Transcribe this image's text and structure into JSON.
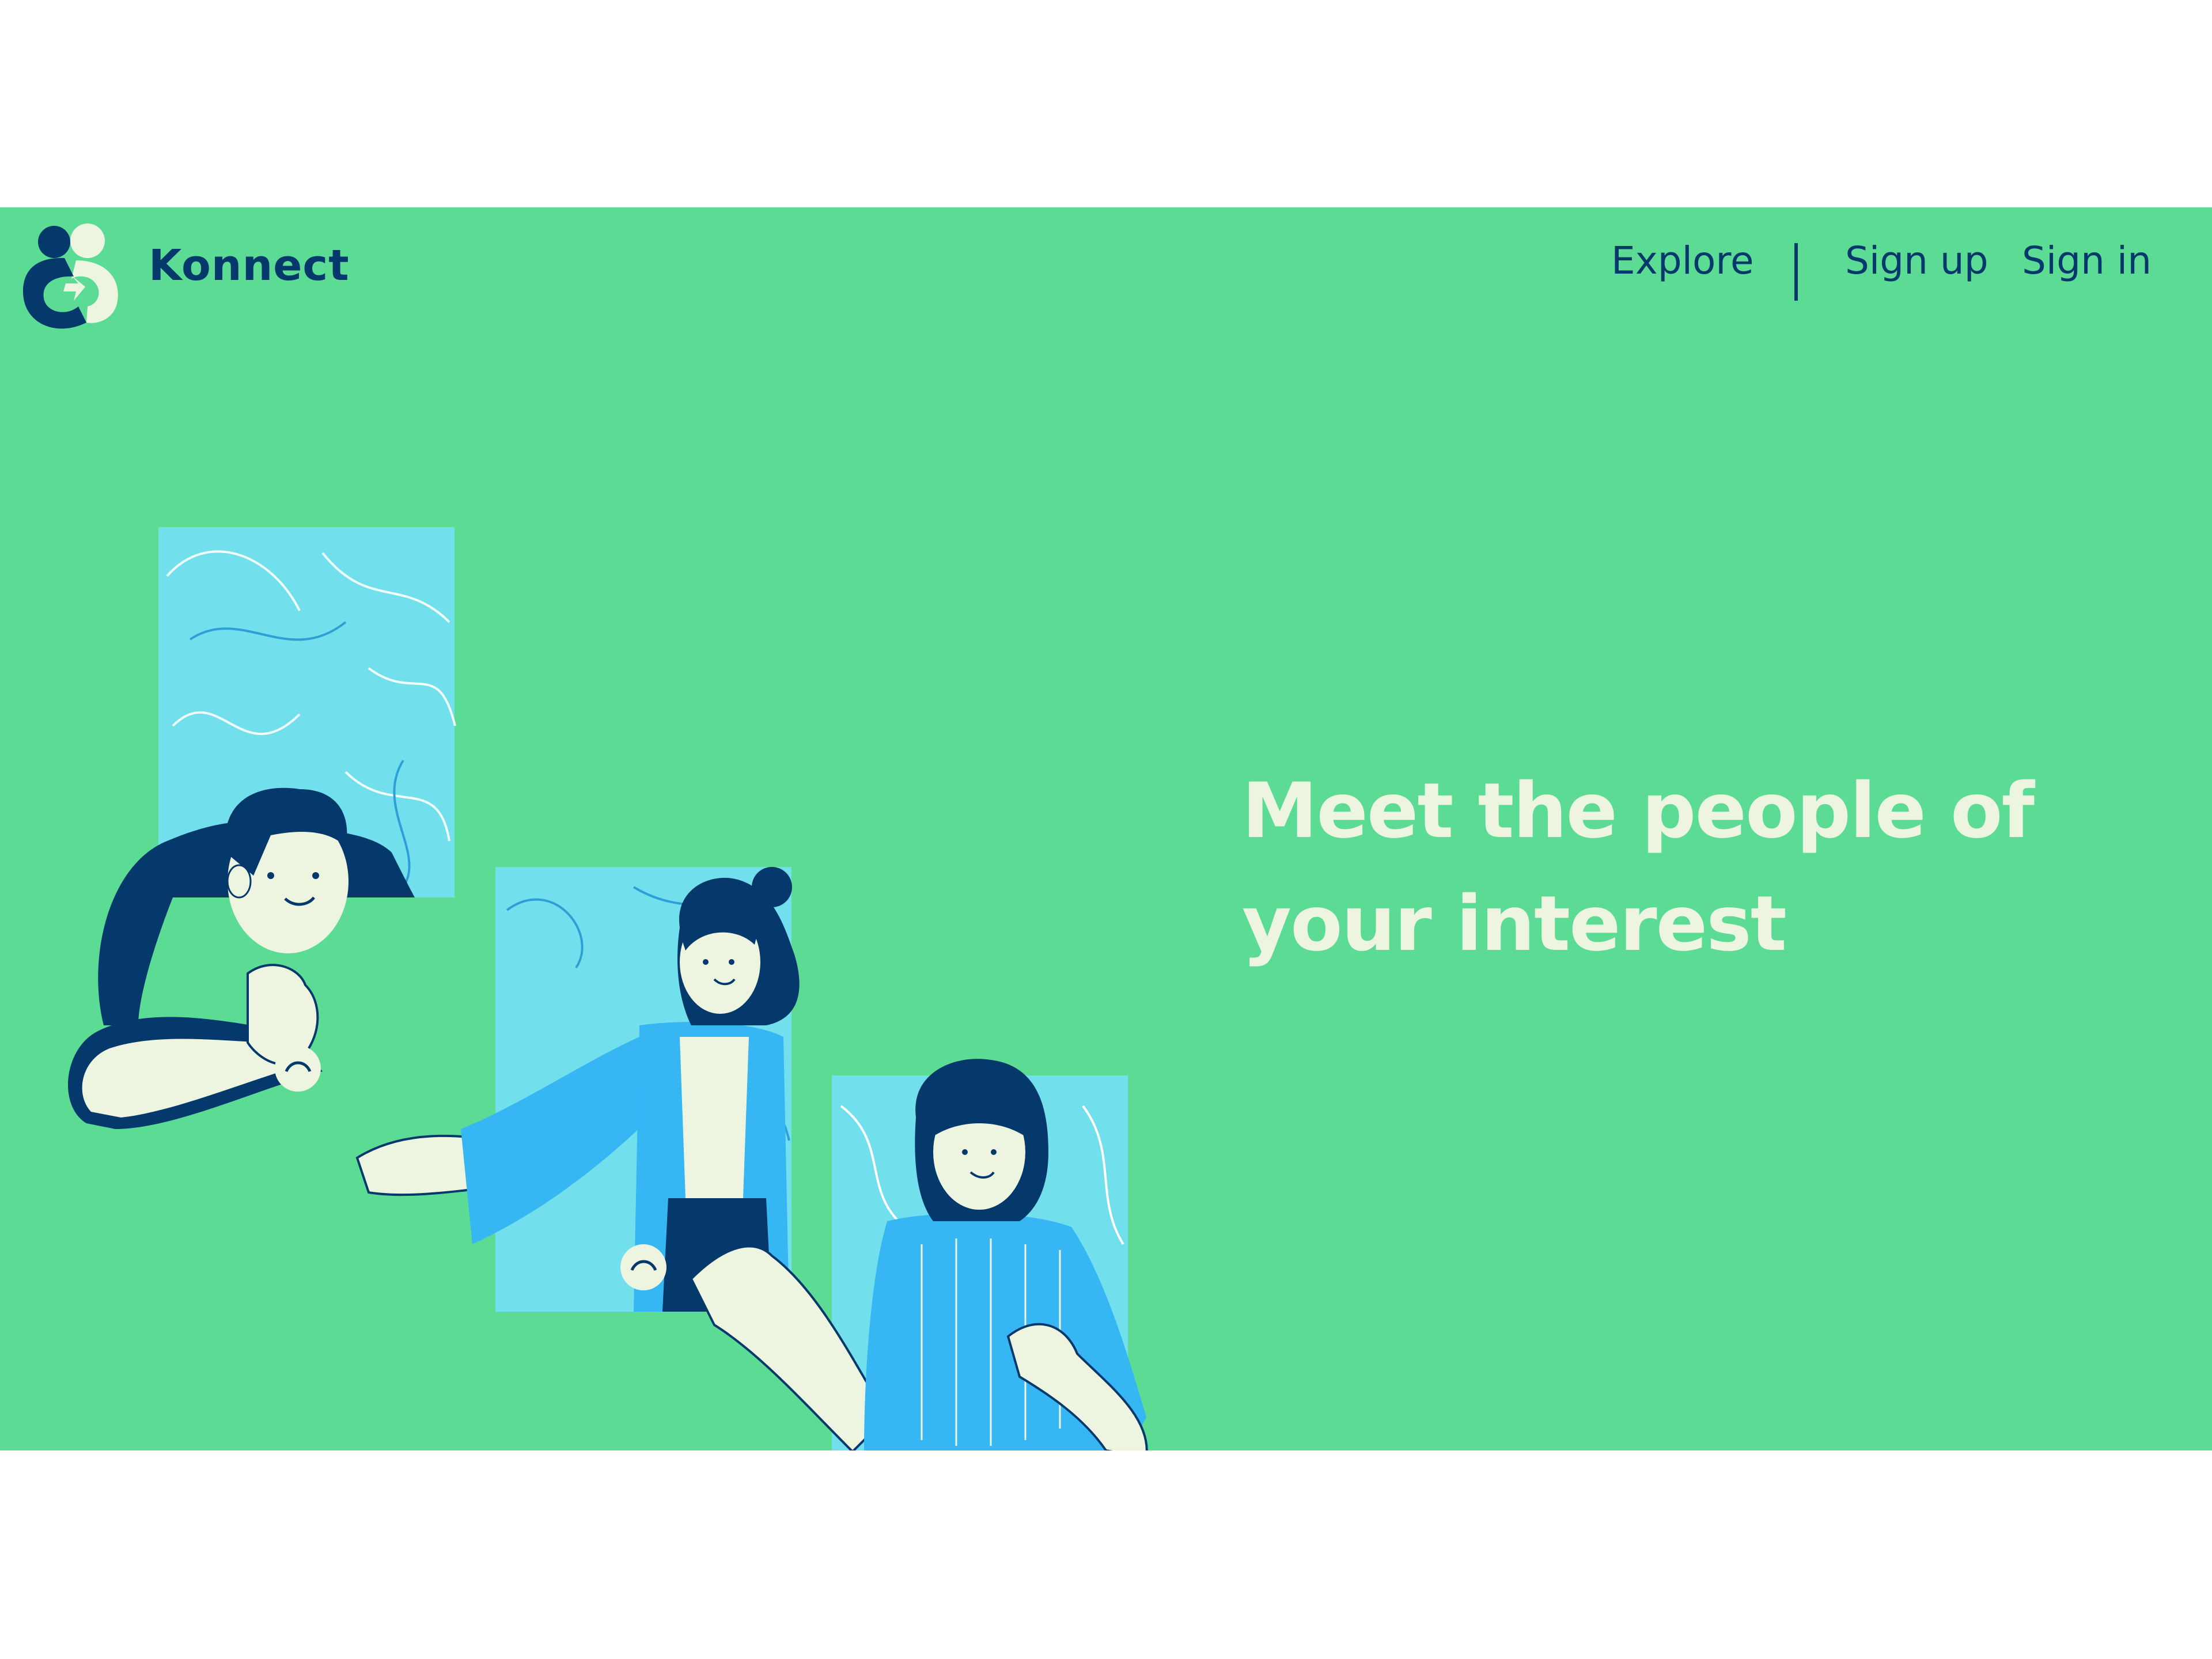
{
  "brand": {
    "name": "Konnect",
    "logo_icon": "handshake-logo-icon"
  },
  "nav": {
    "explore": "Explore",
    "sign_up": "Sign up",
    "sign_in": "Sign in"
  },
  "hero": {
    "headline": "Meet the people of your interest",
    "illustration": "video-call-people-illustration"
  },
  "colors": {
    "hero_background": "#5cdb95",
    "brand_dark": "#05386b",
    "headline_text": "#edf5e1",
    "panel_cyan": "#72e0ec",
    "shirt_blue": "#37b6f4"
  }
}
